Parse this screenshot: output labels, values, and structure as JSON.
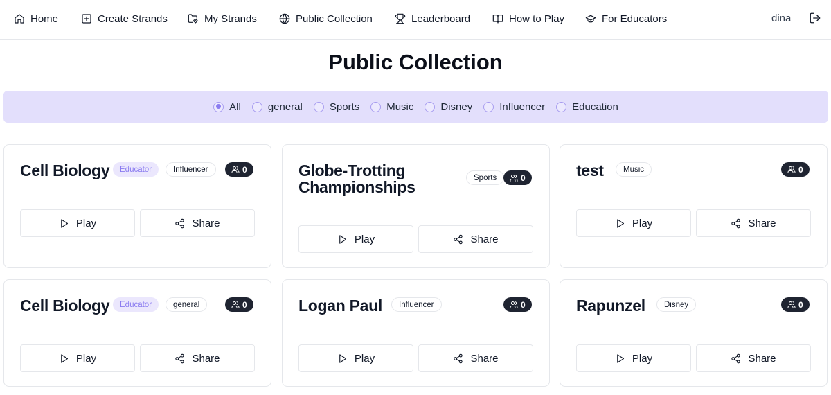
{
  "nav": {
    "home": "Home",
    "create": "Create Strands",
    "my": "My Strands",
    "public": "Public Collection",
    "leaderboard": "Leaderboard",
    "howto": "How to Play",
    "educators": "For Educators",
    "user": "dina"
  },
  "page_title": "Public Collection",
  "filters": [
    "All",
    "general",
    "Sports",
    "Music",
    "Disney",
    "Influencer",
    "Education"
  ],
  "selected_filter": "All",
  "labels": {
    "play": "Play",
    "share": "Share",
    "educator": "Educator"
  },
  "cards": [
    {
      "title": "Cell Biology",
      "educator": true,
      "category": "Influencer",
      "count": "0"
    },
    {
      "title": "Globe-Trotting Championships",
      "educator": false,
      "category": "Sports",
      "count": "0"
    },
    {
      "title": "test",
      "educator": false,
      "category": "Music",
      "count": "0"
    },
    {
      "title": "Cell Biology",
      "educator": true,
      "category": "general",
      "count": "0"
    },
    {
      "title": "Logan Paul",
      "educator": false,
      "category": "Influencer",
      "count": "0"
    },
    {
      "title": "Rapunzel",
      "educator": false,
      "category": "Disney",
      "count": "0"
    }
  ],
  "colors": {
    "accent": "#8b7cf0",
    "filter_bg": "#e3dffc",
    "count_badge": "#1f2431"
  }
}
